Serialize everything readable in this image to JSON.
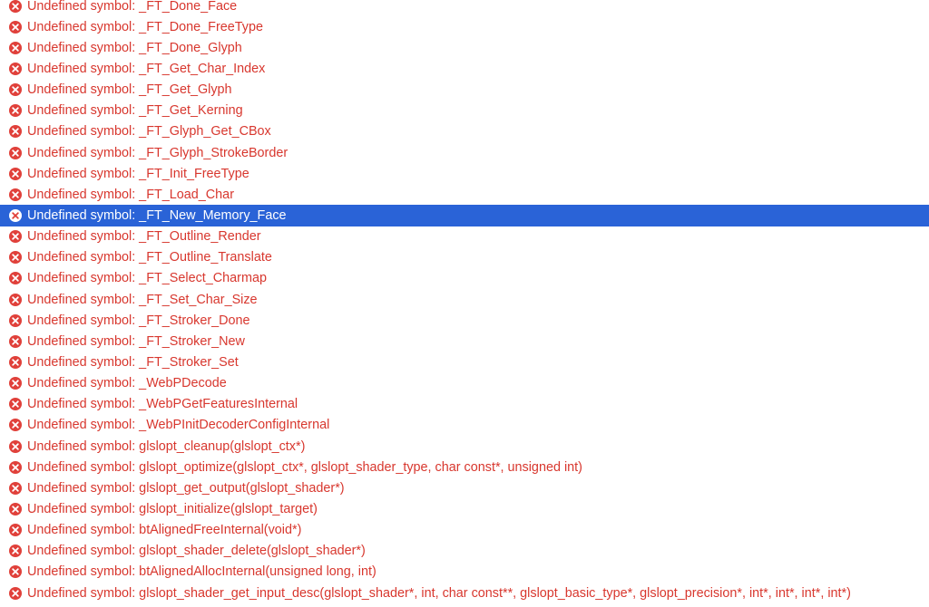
{
  "colors": {
    "error_text": "#d8372e",
    "error_icon": "#e0403a",
    "selection_bg": "#2a63d7",
    "selected_text": "#ffffff"
  },
  "icon": "error-x-circle-icon",
  "selected_index": 10,
  "issues": [
    {
      "message": "Undefined symbol: _FT_Done_Face"
    },
    {
      "message": "Undefined symbol: _FT_Done_FreeType"
    },
    {
      "message": "Undefined symbol: _FT_Done_Glyph"
    },
    {
      "message": "Undefined symbol: _FT_Get_Char_Index"
    },
    {
      "message": "Undefined symbol: _FT_Get_Glyph"
    },
    {
      "message": "Undefined symbol: _FT_Get_Kerning"
    },
    {
      "message": "Undefined symbol: _FT_Glyph_Get_CBox"
    },
    {
      "message": "Undefined symbol: _FT_Glyph_StrokeBorder"
    },
    {
      "message": "Undefined symbol: _FT_Init_FreeType"
    },
    {
      "message": "Undefined symbol: _FT_Load_Char"
    },
    {
      "message": "Undefined symbol: _FT_New_Memory_Face"
    },
    {
      "message": "Undefined symbol: _FT_Outline_Render"
    },
    {
      "message": "Undefined symbol: _FT_Outline_Translate"
    },
    {
      "message": "Undefined symbol: _FT_Select_Charmap"
    },
    {
      "message": "Undefined symbol: _FT_Set_Char_Size"
    },
    {
      "message": "Undefined symbol: _FT_Stroker_Done"
    },
    {
      "message": "Undefined symbol: _FT_Stroker_New"
    },
    {
      "message": "Undefined symbol: _FT_Stroker_Set"
    },
    {
      "message": "Undefined symbol: _WebPDecode"
    },
    {
      "message": "Undefined symbol: _WebPGetFeaturesInternal"
    },
    {
      "message": "Undefined symbol: _WebPInitDecoderConfigInternal"
    },
    {
      "message": "Undefined symbol: glslopt_cleanup(glslopt_ctx*)"
    },
    {
      "message": "Undefined symbol: glslopt_optimize(glslopt_ctx*, glslopt_shader_type, char const*, unsigned int)"
    },
    {
      "message": "Undefined symbol: glslopt_get_output(glslopt_shader*)"
    },
    {
      "message": "Undefined symbol: glslopt_initialize(glslopt_target)"
    },
    {
      "message": "Undefined symbol: btAlignedFreeInternal(void*)"
    },
    {
      "message": "Undefined symbol: glslopt_shader_delete(glslopt_shader*)"
    },
    {
      "message": "Undefined symbol: btAlignedAllocInternal(unsigned long, int)"
    },
    {
      "message": "Undefined symbol: glslopt_shader_get_input_desc(glslopt_shader*, int, char const**, glslopt_basic_type*, glslopt_precision*, int*, int*, int*, int*)"
    }
  ]
}
